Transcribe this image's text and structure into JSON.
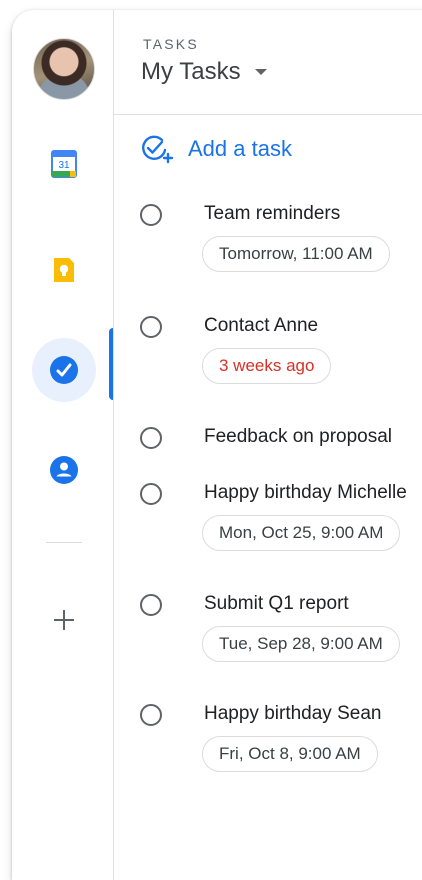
{
  "rail": {
    "items": [
      {
        "name": "calendar",
        "icon": "calendar-icon",
        "label": "31"
      },
      {
        "name": "keep",
        "icon": "keep-bulb-icon"
      },
      {
        "name": "tasks",
        "icon": "tasks-check-icon",
        "active": true
      },
      {
        "name": "contacts",
        "icon": "contacts-person-icon"
      }
    ],
    "add_icon": "plus-icon"
  },
  "header": {
    "eyebrow": "TASKS",
    "title": "My Tasks"
  },
  "add_task": {
    "label": "Add a task",
    "icon": "add-task-icon"
  },
  "tasks": [
    {
      "title": "Team reminders",
      "chip": "Tomorrow, 11:00 AM"
    },
    {
      "title": "Contact Anne",
      "chip": "3 weeks ago",
      "overdue": true
    },
    {
      "title": "Feedback on proposal"
    },
    {
      "title": "Happy birthday Michelle",
      "chip": "Mon, Oct 25, 9:00 AM"
    },
    {
      "title": "Submit Q1 report",
      "chip": "Tue, Sep 28, 9:00 AM"
    },
    {
      "title": "Happy birthday Sean",
      "chip": "Fri, Oct 8, 9:00 AM"
    }
  ],
  "colors": {
    "accent": "#1a73e8",
    "overdue": "#d93025",
    "keep": "#fbbc04",
    "active_bg": "#e8f0fe"
  }
}
